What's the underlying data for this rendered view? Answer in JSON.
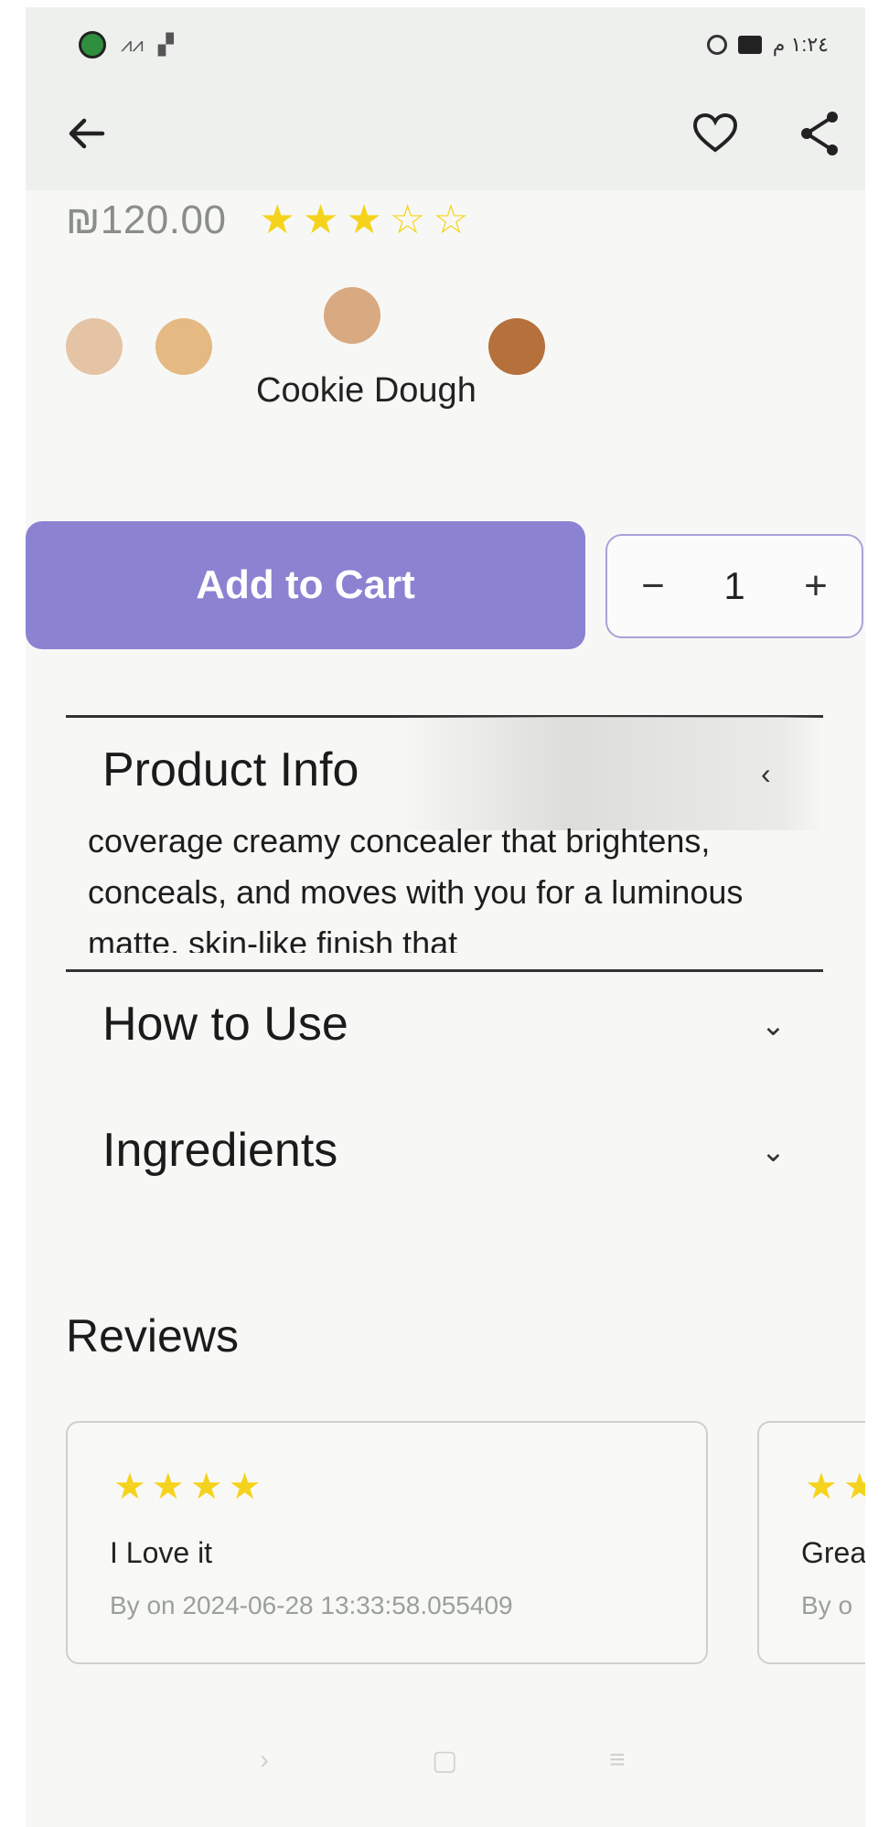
{
  "status_bar": {
    "time": "١:٢٤ م"
  },
  "product": {
    "price": "₪120.00",
    "rating": 3,
    "rating_max": 5,
    "shades": [
      {
        "color": "#e4c4a5"
      },
      {
        "color": "#e5b982"
      },
      {
        "color": "#d9a981"
      },
      {
        "color": "#b5703c"
      }
    ],
    "selected_shade_name": "Cookie Dough"
  },
  "actions": {
    "add_to_cart": "Add to Cart",
    "minus": "−",
    "quantity": "1",
    "plus": "+"
  },
  "sections": [
    {
      "title": "Product Info",
      "expanded": true,
      "chevron": "‹"
    },
    {
      "title": "How to Use",
      "expanded": false,
      "chevron": "⌄"
    },
    {
      "title": "Ingredients",
      "expanded": false,
      "chevron": "⌄"
    }
  ],
  "product_info_text": "coverage creamy concealer that brightens, conceals, and moves with you for a luminous matte, skin-like finish that",
  "reviews": {
    "title": "Reviews",
    "items": [
      {
        "stars": 4,
        "title": "I Love it",
        "meta": "By  on 2024-06-28 13:33:58.055409"
      },
      {
        "stars": 2,
        "title": "Grea",
        "meta": "By o"
      }
    ]
  },
  "nav": {
    "back": "›",
    "home": "▢",
    "recents": "≡"
  },
  "colors": {
    "accent": "#8b82d2",
    "star": "#f5d31d"
  }
}
